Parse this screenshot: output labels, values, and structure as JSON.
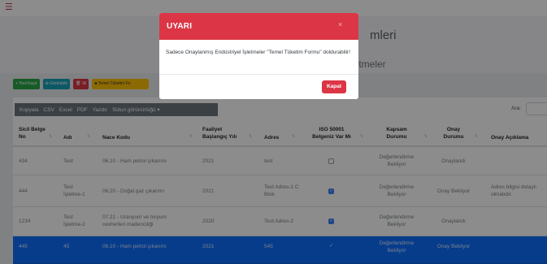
{
  "header": {
    "menu_icon": "hamburger-icon",
    "title_partial": "mleri",
    "subtitle_partial": "letmeler"
  },
  "actions": {
    "new": "+ Yeni Kayıt",
    "view": "⊕ Görüntüle",
    "delete": "🗑 Sil",
    "fill_form": "■ Temel Tüketim Fo"
  },
  "toolbar": {
    "copy": "Kopyala",
    "csv": "CSV",
    "excel": "Excel",
    "pdf": "PDF",
    "print": "Yazdır",
    "column_visibility": "Sütun görünürlüğü ▾",
    "search_label": "Ara:"
  },
  "table": {
    "headers": {
      "sicil_1": "Sicil Belge",
      "sicil_2": "No",
      "adi": "Adı",
      "nace": "Nace Kodu",
      "faaliyet_1": "Faaliyet",
      "faaliyet_2": "Başlangıç Yılı",
      "adres": "Adres",
      "iso_1": "ISO 50001",
      "iso_2": "Belgeniz Var Mı",
      "kapsam_1": "Kapsam",
      "kapsam_2": "Durumu",
      "onay_1": "Onay",
      "onay_2": "Durumu",
      "onay_aciklama": "Onay Açıklama"
    },
    "sort_glyph": "⇅",
    "rows": [
      {
        "sicil": "434",
        "adi_1": "Test",
        "adi_2": "",
        "nace_1": "06.10 - Ham petrol çıkarımı",
        "nace_2": "",
        "faaliyet": "2021",
        "adres_1": "test",
        "adres_2": "",
        "iso": false,
        "kapsam_1": "Değerlendirme",
        "kapsam_2": "Bekliyor",
        "onay": "Onaylandı",
        "aciklama_1": "",
        "aciklama_2": ""
      },
      {
        "sicil": "444",
        "adi_1": "Test",
        "adi_2": "İşletme-1",
        "nace_1": "06.20 - Doğal gaz çıkarımı",
        "nace_2": "",
        "faaliyet": "2021",
        "adres_1": "Test Adres-1 C",
        "adres_2": "Blok",
        "iso": true,
        "kapsam_1": "Değerlendirme",
        "kapsam_2": "Bekliyor",
        "onay": "Onay Bekliyor",
        "aciklama_1": "Adres bilgisi detaylı",
        "aciklama_2": "olmalıdır."
      },
      {
        "sicil": "1234",
        "adi_1": "Test",
        "adi_2": "İşletme-2",
        "nace_1": "07.21 - Uranyum ve toryum",
        "nace_2": "cevherleri madenciliği",
        "faaliyet": "2020",
        "adres_1": "Test Adres-2",
        "adres_2": "",
        "iso": true,
        "kapsam_1": "Değerlendirme",
        "kapsam_2": "Bekliyor",
        "onay": "Onaylandı",
        "aciklama_1": "",
        "aciklama_2": ""
      },
      {
        "sicil": "445",
        "adi_1": "45",
        "adi_2": "",
        "nace_1": "06.10 - Ham petrol çıkarımı",
        "nace_2": "",
        "faaliyet": "2021",
        "adres_1": "545",
        "adres_2": "",
        "iso": true,
        "kapsam_1": "Değerlendirme",
        "kapsam_2": "Bekliyor",
        "onay": "Onay Bekliyor",
        "aciklama_1": "",
        "aciklama_2": ""
      }
    ]
  },
  "modal": {
    "title": "UYARI",
    "close_glyph": "×",
    "message": "Sadece Onaylanmış Endüstriyel İşletmeler \"Temel Tüketim Formu\" doldurabilir!",
    "button": "Kapat"
  },
  "colors": {
    "danger": "#dc3545",
    "selected_row": "#0d6efd",
    "toolbar": "#6c757d"
  }
}
